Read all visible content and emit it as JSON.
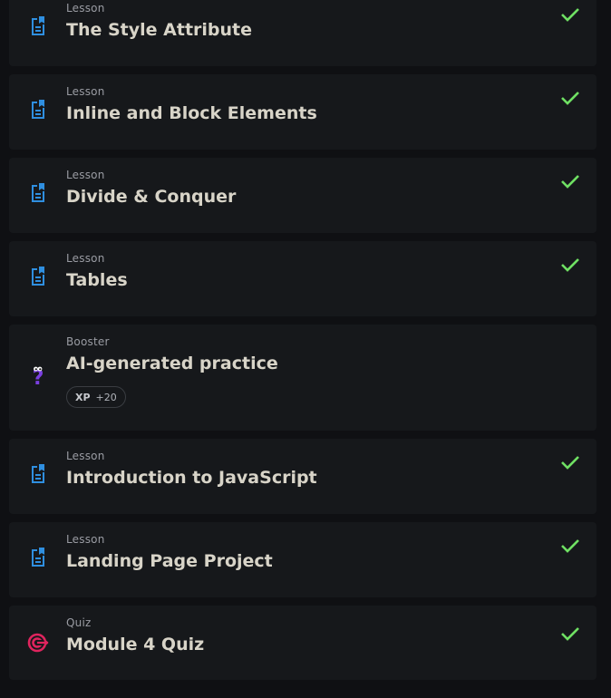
{
  "items": [
    {
      "kind": "Lesson",
      "title": "The Style Attribute",
      "icon": "lesson-doc-icon",
      "completed": true
    },
    {
      "kind": "Lesson",
      "title": "Inline and Block Elements",
      "icon": "lesson-doc-icon",
      "completed": true
    },
    {
      "kind": "Lesson",
      "title": "Divide & Conquer",
      "icon": "lesson-doc-icon",
      "completed": true
    },
    {
      "kind": "Lesson",
      "title": "Tables",
      "icon": "lesson-doc-icon",
      "completed": true
    },
    {
      "kind": "Booster",
      "title": "AI-generated practice",
      "icon": "question-mark-icon",
      "completed": false,
      "xp_label": "XP",
      "xp_value": "+20"
    },
    {
      "kind": "Lesson",
      "title": "Introduction to JavaScript",
      "icon": "lesson-doc-icon",
      "completed": true
    },
    {
      "kind": "Lesson",
      "title": "Landing Page Project",
      "icon": "lesson-doc-icon",
      "completed": true
    },
    {
      "kind": "Quiz",
      "title": "Module 4 Quiz",
      "icon": "target-icon",
      "completed": true
    }
  ],
  "colors": {
    "background": "#0f1013",
    "card": "#16181b",
    "lesson_icon": "#2f8fe0",
    "check": "#6fe063",
    "booster_icon": "#7a3fe0",
    "quiz_icon": "#e0245e"
  }
}
